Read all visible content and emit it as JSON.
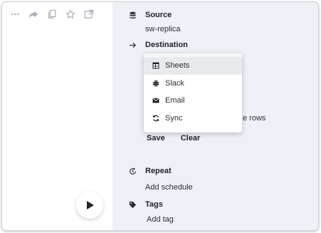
{
  "toolbar": {
    "icons": [
      "more-icon",
      "share-icon",
      "copy-icon",
      "star-icon",
      "open-external-icon"
    ]
  },
  "source": {
    "heading": "Source",
    "value": "sw-replica"
  },
  "destination": {
    "heading": "Destination",
    "options": [
      {
        "label": "Sheets",
        "icon": "table-icon",
        "highlighted": true
      },
      {
        "label": "Slack",
        "icon": "slack-icon",
        "highlighted": false
      },
      {
        "label": "Email",
        "icon": "envelope-icon",
        "highlighted": false
      },
      {
        "label": "Sync",
        "icon": "sync-icon",
        "highlighted": false
      }
    ],
    "partial_text": "e rows"
  },
  "actions": {
    "save_label": "Save",
    "clear_label": "Clear"
  },
  "repeat": {
    "heading": "Repeat",
    "link": "Add schedule"
  },
  "tags": {
    "heading": "Tags",
    "link": "Add tag"
  },
  "colors": {
    "panel_bg": "#eef1f6",
    "highlight": "#e9eaed",
    "text": "#1e2329"
  }
}
